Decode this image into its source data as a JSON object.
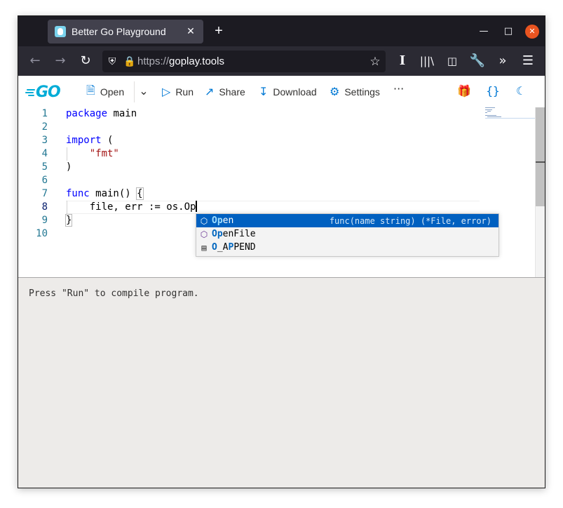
{
  "browser": {
    "tab_title": "Better Go Playground",
    "url_scheme": "https://",
    "url_host": "goplay.tools",
    "new_tab": "+",
    "tab_close": "✕"
  },
  "toolbar": {
    "logo_text": "GO",
    "open_label": "Open",
    "run_label": "Run",
    "share_label": "Share",
    "download_label": "Download",
    "settings_label": "Settings",
    "more_label": "···"
  },
  "editor": {
    "line_numbers": [
      "1",
      "2",
      "3",
      "4",
      "5",
      "6",
      "7",
      "8",
      "9",
      "10"
    ],
    "lines": {
      "l1_kw": "package",
      "l1_rest": " main",
      "l3_kw": "import",
      "l3_rest": " (",
      "l4_str": "\"fmt\"",
      "l5": ")",
      "l7_kw": "func",
      "l7_rest": " main() ",
      "l7_brace": "{",
      "l8": "    file, err := os.Op",
      "l9": "}"
    }
  },
  "suggest": {
    "items": [
      {
        "hl": "Op",
        "rest": "en",
        "detail": "func(name string) (*File, error)",
        "kind": "function"
      },
      {
        "hl": "Op",
        "rest": "enFile",
        "detail": "",
        "kind": "function"
      },
      {
        "pre": "O",
        "mid": "_A",
        "hl": "P",
        "rest": "PEND",
        "detail": "",
        "kind": "constant"
      }
    ]
  },
  "output": {
    "text": "Press \"Run\" to compile program."
  },
  "colors": {
    "accent": "#0078d4",
    "go_brand": "#00acd7",
    "selection": "#0060c0"
  }
}
